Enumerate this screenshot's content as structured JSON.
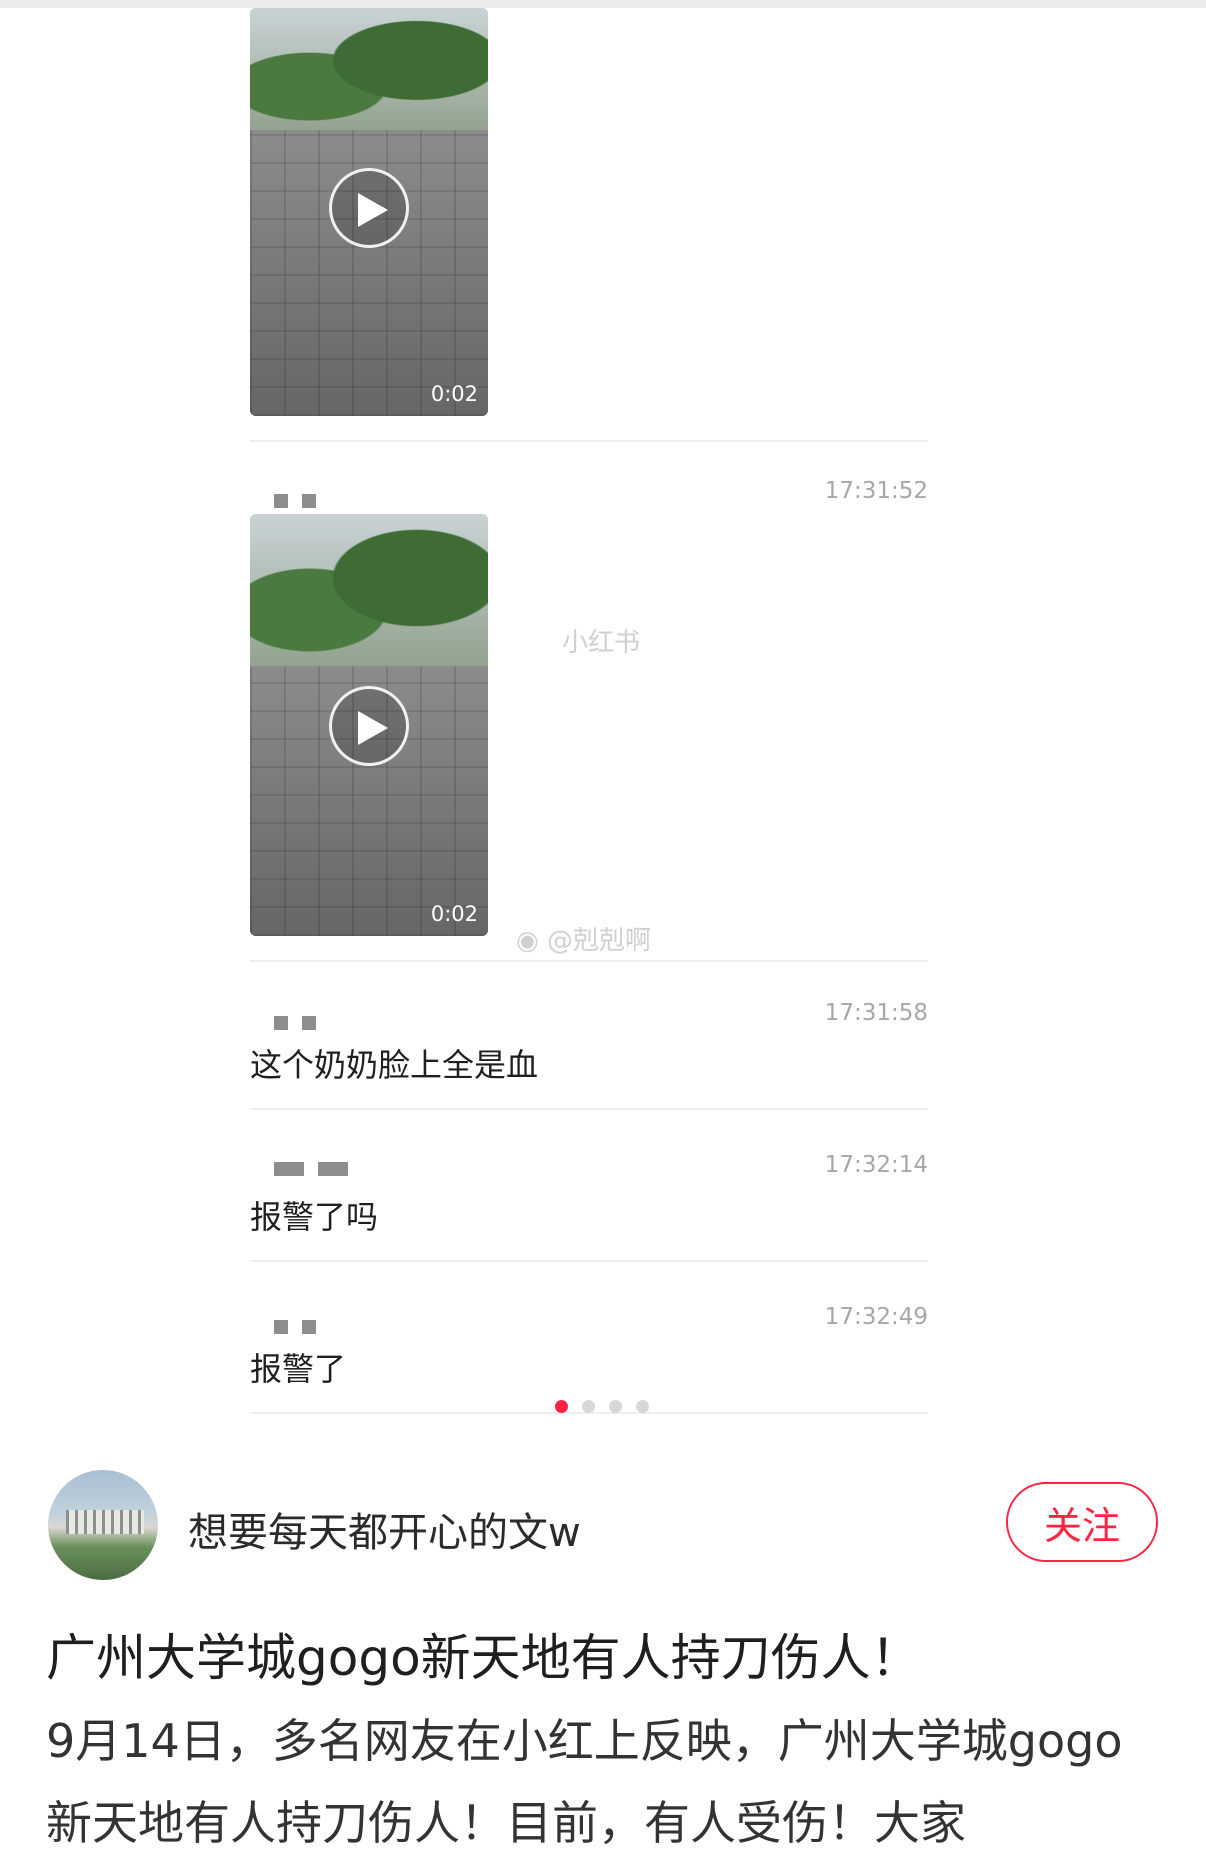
{
  "videos": [
    {
      "duration": "0:02"
    },
    {
      "duration": "0:02"
    }
  ],
  "messages": [
    {
      "timestamp": "17:31:52",
      "text": ""
    },
    {
      "timestamp": "17:31:58",
      "text": "这个奶奶脸上全是血"
    },
    {
      "timestamp": "17:32:14",
      "text": "报警了吗"
    },
    {
      "timestamp": "17:32:49",
      "text": "报警了"
    }
  ],
  "watermarks": {
    "xiaohongshu": "小红书",
    "weibo": "@剋剋啊"
  },
  "pager": {
    "count": 4,
    "active": 0
  },
  "post": {
    "author": "想要每天都开心的文w",
    "follow_label": "关注",
    "title": "广州大学城gogo新天地有人持刀伤人！",
    "body": "9月14日，多名网友在小红上反映，广州大学城gogo新天地有人持刀伤人！目前，有人受伤！大家"
  },
  "colors": {
    "accent": "#ff2442"
  }
}
